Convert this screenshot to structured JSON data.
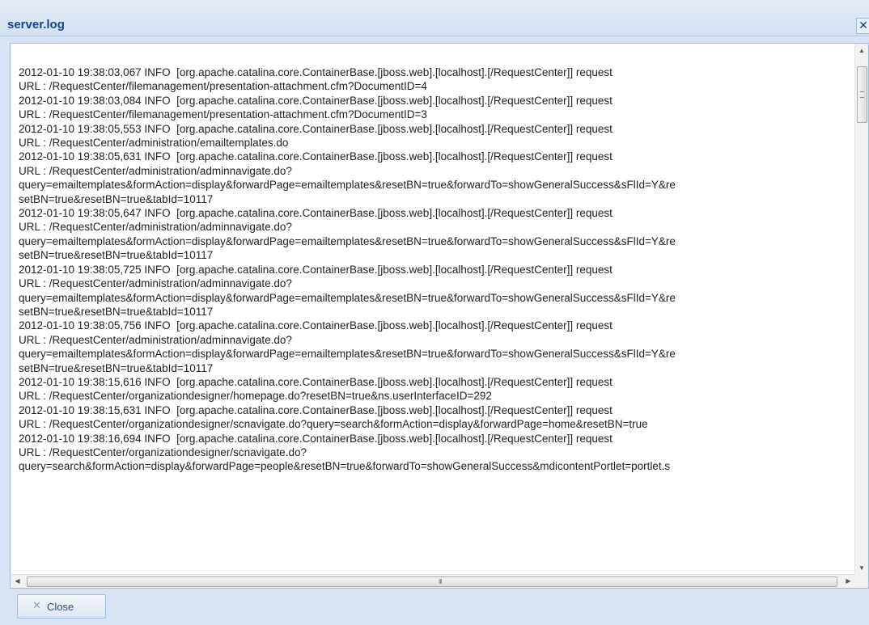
{
  "window": {
    "title": "server.log",
    "close_glyph": "✕"
  },
  "log": {
    "lines": [
      "2012-01-10 19:38:03,067 INFO  [org.apache.catalina.core.ContainerBase.[jboss.web].[localhost].[/RequestCenter]] request",
      "URL : /RequestCenter/filemanagement/presentation-attachment.cfm?DocumentID=4",
      "2012-01-10 19:38:03,084 INFO  [org.apache.catalina.core.ContainerBase.[jboss.web].[localhost].[/RequestCenter]] request",
      "URL : /RequestCenter/filemanagement/presentation-attachment.cfm?DocumentID=3",
      "2012-01-10 19:38:05,553 INFO  [org.apache.catalina.core.ContainerBase.[jboss.web].[localhost].[/RequestCenter]] request",
      "URL : /RequestCenter/administration/emailtemplates.do",
      "2012-01-10 19:38:05,631 INFO  [org.apache.catalina.core.ContainerBase.[jboss.web].[localhost].[/RequestCenter]] request",
      "URL : /RequestCenter/administration/adminnavigate.do?",
      "query=emailtemplates&formAction=display&forwardPage=emailtemplates&resetBN=true&forwardTo=showGeneralSuccess&sFlId=Y&re",
      "setBN=true&resetBN=true&tabId=10117",
      "2012-01-10 19:38:05,647 INFO  [org.apache.catalina.core.ContainerBase.[jboss.web].[localhost].[/RequestCenter]] request",
      "URL : /RequestCenter/administration/adminnavigate.do?",
      "query=emailtemplates&formAction=display&forwardPage=emailtemplates&resetBN=true&forwardTo=showGeneralSuccess&sFlId=Y&re",
      "setBN=true&resetBN=true&tabId=10117",
      "2012-01-10 19:38:05,725 INFO  [org.apache.catalina.core.ContainerBase.[jboss.web].[localhost].[/RequestCenter]] request",
      "URL : /RequestCenter/administration/adminnavigate.do?",
      "query=emailtemplates&formAction=display&forwardPage=emailtemplates&resetBN=true&forwardTo=showGeneralSuccess&sFlId=Y&re",
      "setBN=true&resetBN=true&tabId=10117",
      "2012-01-10 19:38:05,756 INFO  [org.apache.catalina.core.ContainerBase.[jboss.web].[localhost].[/RequestCenter]] request",
      "URL : /RequestCenter/administration/adminnavigate.do?",
      "query=emailtemplates&formAction=display&forwardPage=emailtemplates&resetBN=true&forwardTo=showGeneralSuccess&sFlId=Y&re",
      "setBN=true&resetBN=true&tabId=10117",
      "2012-01-10 19:38:15,616 INFO  [org.apache.catalina.core.ContainerBase.[jboss.web].[localhost].[/RequestCenter]] request",
      "URL : /RequestCenter/organizationdesigner/homepage.do?resetBN=true&ns.userInterfaceID=292",
      "2012-01-10 19:38:15,631 INFO  [org.apache.catalina.core.ContainerBase.[jboss.web].[localhost].[/RequestCenter]] request",
      "URL : /RequestCenter/organizationdesigner/scnavigate.do?query=search&formAction=display&forwardPage=home&resetBN=true",
      "2012-01-10 19:38:16,694 INFO  [org.apache.catalina.core.ContainerBase.[jboss.web].[localhost].[/RequestCenter]] request",
      "URL : /RequestCenter/organizationdesigner/scnavigate.do?",
      "query=search&formAction=display&forwardPage=people&resetBN=true&forwardTo=showGeneralSuccess&mdicontentPortlet=portlet.s"
    ]
  },
  "scrollbars": {
    "up_glyph": "▲",
    "down_glyph": "▼",
    "left_glyph": "◀",
    "right_glyph": "▶",
    "h_grip": "III"
  },
  "footer": {
    "close_button_label": "Close",
    "close_button_icon": "close-x-icon",
    "close_button_glyph": "✕"
  }
}
